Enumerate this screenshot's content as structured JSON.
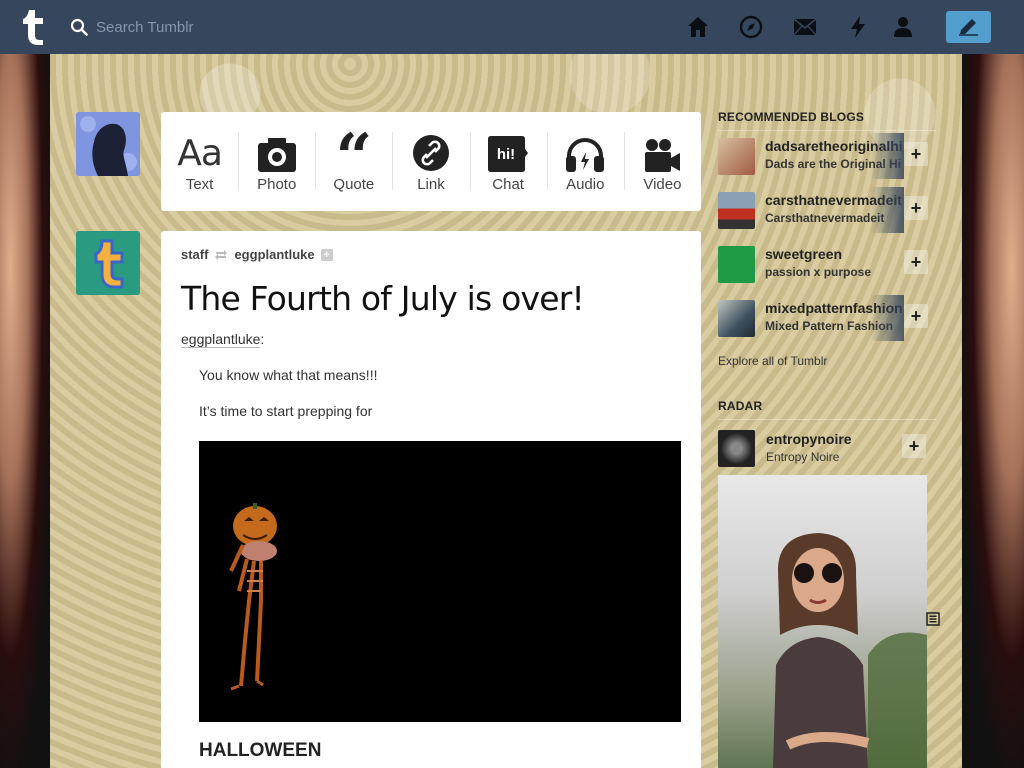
{
  "header": {
    "search_placeholder": "Search Tumblr",
    "icons": [
      "tumblr-logo-icon",
      "search-icon",
      "home-icon",
      "explore-icon",
      "inbox-icon",
      "activity-icon",
      "account-icon",
      "compose-icon"
    ],
    "accent_color": "#36465d",
    "compose_color": "#529ecc"
  },
  "post_types": [
    {
      "label": "Text",
      "icon": "text-icon"
    },
    {
      "label": "Photo",
      "icon": "camera-icon"
    },
    {
      "label": "Quote",
      "icon": "quote-icon"
    },
    {
      "label": "Link",
      "icon": "link-icon"
    },
    {
      "label": "Chat",
      "icon": "chat-icon",
      "glyph": "hi!"
    },
    {
      "label": "Audio",
      "icon": "headphones-icon"
    },
    {
      "label": "Video",
      "icon": "video-camera-icon"
    }
  ],
  "post": {
    "author": "staff",
    "reblogged_from": "eggplantluke",
    "title": "The Fourth of July is over!",
    "quote_author": "eggplantluke",
    "quote_author_suffix": ":",
    "lines": [
      "You know what that means!!!",
      "It’s time to start prepping for"
    ],
    "heading": "HALLOWEEN"
  },
  "recommended": {
    "heading": "RECOMMENDED BLOGS",
    "blogs": [
      {
        "name": "dadsaretheoriginalhi",
        "title": "Dads are the Original Hi",
        "thumb_color": "#c98a6a"
      },
      {
        "name": "carsthatnevermadeit",
        "title": "Carsthatnevermadeit",
        "thumb_color": "#6a7d92"
      },
      {
        "name": "sweetgreen",
        "title": "passion x purpose",
        "thumb_color": "#1f9b45"
      },
      {
        "name": "mixedpatternfashion",
        "title": "Mixed Pattern Fashion",
        "thumb_color": "#4a5a6a"
      }
    ],
    "explore_label": "Explore all of Tumblr"
  },
  "radar": {
    "heading": "RADAR",
    "name": "entropynoire",
    "title": "Entropy Noire"
  }
}
